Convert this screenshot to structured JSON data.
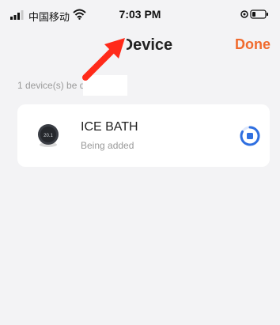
{
  "status_bar": {
    "carrier": "中国移动",
    "time": "7:03 PM"
  },
  "nav": {
    "title": "d Device",
    "done_label": "Done"
  },
  "section": {
    "label": "1 device(s) be d"
  },
  "device": {
    "name": "ICE BATH",
    "status": "Being added",
    "thumb_text": "20.1"
  },
  "colors": {
    "accent": "#f06a2d",
    "spinner": "#2f6fe0",
    "background": "#f3f3f5",
    "card": "#ffffff",
    "annotation_arrow": "#ff2a1a"
  },
  "icons": {
    "signal": "signal-icon",
    "wifi": "wifi-icon",
    "location": "location-icon",
    "battery": "battery-icon",
    "spinner": "loading-spinner-icon",
    "arrow": "red-arrow-icon"
  }
}
